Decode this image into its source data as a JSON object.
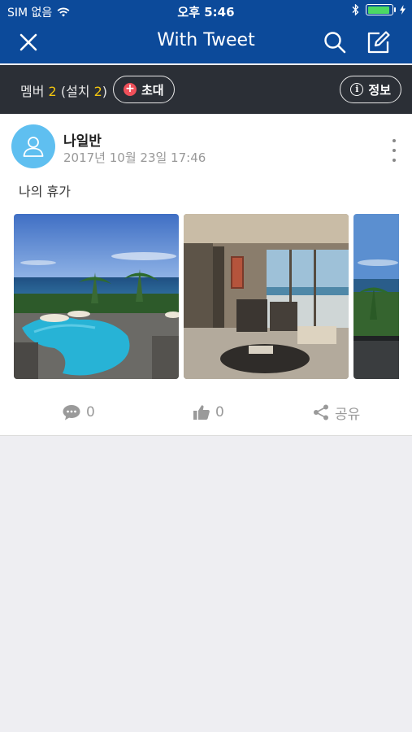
{
  "status": {
    "carrier": "SIM 없음",
    "time": "오후 5:46",
    "battery_level": 0.9,
    "battery_color": "#4cd964"
  },
  "nav": {
    "title": "With Tweet",
    "close_icon": "close-icon",
    "search_icon": "search-icon",
    "compose_icon": "compose-icon"
  },
  "members": {
    "label": "멤버",
    "count": "2",
    "installed_label": "(설치",
    "installed_count": "2",
    "installed_close": ")",
    "invite_label": "초대",
    "info_label": "정보"
  },
  "post": {
    "author": "나일반",
    "timestamp": "2017년 10월 23일 17:46",
    "text": "나의 휴가",
    "photos": [
      "resort-pool-photo",
      "hotel-room-photo",
      "ocean-view-photo"
    ],
    "comments": "0",
    "likes": "0",
    "share_label": "공유"
  },
  "colors": {
    "header": "#0c4a9a",
    "toolbar": "#2b2f36",
    "accent_count": "#f1c40f",
    "avatar": "#5fbff0",
    "invite_dot": "#f0505a"
  }
}
